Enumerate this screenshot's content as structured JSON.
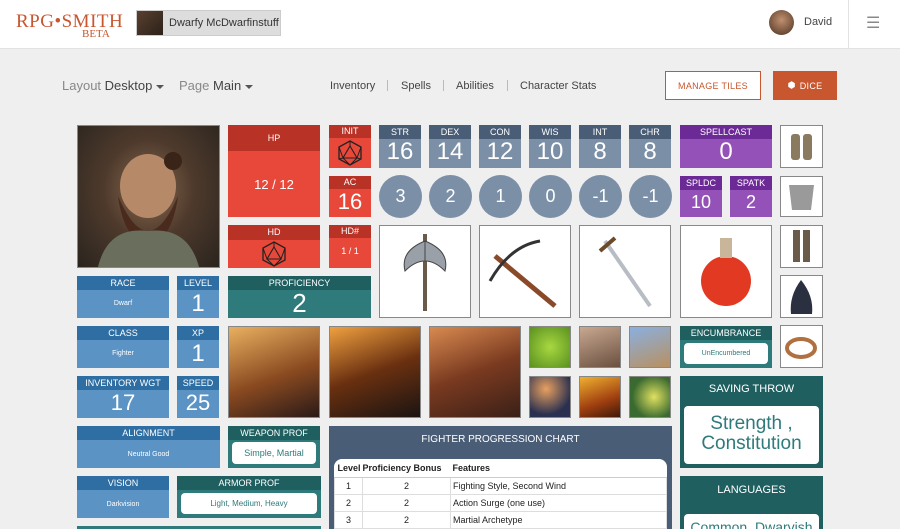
{
  "header": {
    "logo_main": "RPG•SMITH",
    "logo_sub": "BETA",
    "character_name": "Dwarfy McDwarfinstuff",
    "user_name": "David",
    "menu_icon": "hamburger-icon"
  },
  "toolbar": {
    "layout_label": "Layout",
    "layout_value": "Desktop",
    "page_label": "Page",
    "page_value": "Main",
    "nav": [
      "Inventory",
      "Spells",
      "Abilities",
      "Character Stats"
    ],
    "manage_tiles": "MANAGE TILES",
    "dice": "DICE",
    "dice_icon": "dice-icon"
  },
  "tiles": {
    "hp_label": "HP",
    "hp_value": "12 / 12",
    "init_label": "INIT",
    "ac_label": "AC",
    "ac_value": "16",
    "hd_label": "HD",
    "hdn_label": "HD#",
    "hdn_value": "1 / 1",
    "stats": [
      {
        "label": "STR",
        "value": "16",
        "mod": "3"
      },
      {
        "label": "DEX",
        "value": "14",
        "mod": "2"
      },
      {
        "label": "CON",
        "value": "12",
        "mod": "1"
      },
      {
        "label": "WIS",
        "value": "10",
        "mod": "0"
      },
      {
        "label": "INT",
        "value": "8",
        "mod": "-1"
      },
      {
        "label": "CHR",
        "value": "8",
        "mod": "-1"
      }
    ],
    "spellcast_label": "SPELLCAST",
    "spellcast_value": "0",
    "spldc_label": "SPLDC",
    "spldc_value": "10",
    "spatk_label": "SPATK",
    "spatk_value": "2",
    "race_label": "RACE",
    "race_value": "Dwarf",
    "level_label": "LEVEL",
    "level_value": "1",
    "proficiency_label": "PROFICIENCY",
    "proficiency_value": "2",
    "class_label": "CLASS",
    "class_value": "Fighter",
    "xp_label": "XP",
    "xp_value": "1",
    "inv_label": "INVENTORY WGT",
    "inv_value": "17",
    "speed_label": "SPEED",
    "speed_value": "25",
    "alignment_label": "ALIGNMENT",
    "alignment_value": "Neutral Good",
    "weapon_label": "WEAPON PROF",
    "weapon_value": "Simple, Martial",
    "vision_label": "VISION",
    "vision_value": "Darkvision",
    "armor_label": "ARMOR PROF",
    "armor_value": "Light, Medium, Heavy",
    "encumbrance_label": "ENCUMBRANCE",
    "encumbrance_value": "UnEncumbered",
    "saving_label": "SAVING THROW",
    "saving_value": "Strength , Constitution",
    "languages_label": "LANGUAGES",
    "languages_value": "Common, Dwarvish"
  },
  "chart": {
    "title": "FIGHTER PROGRESSION CHART",
    "headers": [
      "Level",
      "Proficiency Bonus",
      "Features"
    ],
    "rows": [
      [
        "1",
        "2",
        "Fighting Style, Second Wind"
      ],
      [
        "2",
        "2",
        "Action Surge (one use)"
      ],
      [
        "3",
        "2",
        "Martial Archetype"
      ]
    ]
  }
}
